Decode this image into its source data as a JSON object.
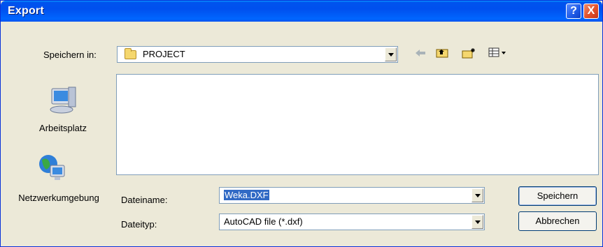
{
  "window": {
    "title": "Export",
    "help_label": "?",
    "close_label": "X"
  },
  "save_in": {
    "label": "Speichern in:",
    "value": "PROJECT"
  },
  "toolbar": {
    "back_icon": "arrow-left-icon",
    "up_icon": "folder-up-icon",
    "new_folder_icon": "new-folder-icon",
    "view_icon": "view-menu-icon"
  },
  "places": [
    {
      "label": "Arbeitsplatz",
      "icon": "my-computer-icon"
    },
    {
      "label": "Netzwerkumgebung",
      "icon": "network-places-icon"
    }
  ],
  "filename": {
    "label": "Dateiname:",
    "value": "Weka.DXF"
  },
  "filetype": {
    "label": "Dateityp:",
    "value": "AutoCAD file (*.dxf)"
  },
  "buttons": {
    "save": "Speichern",
    "cancel": "Abbrechen"
  }
}
